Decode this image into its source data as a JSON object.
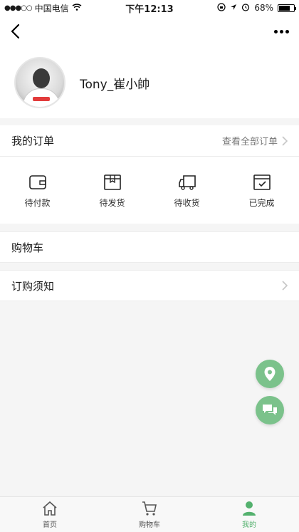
{
  "status_bar": {
    "carrier": "中国电信",
    "time": "下午12:13",
    "battery": "68%",
    "battery_level": 0.68
  },
  "nav": {
    "back_icon": "chevron-left-icon",
    "more_icon": "more-icon"
  },
  "profile": {
    "username": "Tony_崔小帥"
  },
  "orders": {
    "title": "我的订单",
    "view_all": "查看全部订单",
    "items": [
      {
        "label": "待付款",
        "icon": "wallet-icon"
      },
      {
        "label": "待发货",
        "icon": "box-icon"
      },
      {
        "label": "待收货",
        "icon": "truck-icon"
      },
      {
        "label": "已完成",
        "icon": "check-box-icon"
      }
    ]
  },
  "cart": {
    "label": "购物车"
  },
  "notice": {
    "label": "订购须知"
  },
  "fabs": [
    {
      "icon": "location-icon"
    },
    {
      "icon": "chat-icon"
    }
  ],
  "tabbar": {
    "tabs": [
      {
        "label": "首页",
        "icon": "home-icon",
        "active": false
      },
      {
        "label": "购物车",
        "icon": "cart-icon",
        "active": false
      },
      {
        "label": "我的",
        "icon": "user-icon",
        "active": true
      }
    ]
  },
  "colors": {
    "accent": "#54b16e",
    "fab": "#7bc28b",
    "background": "#f5f5f5"
  }
}
